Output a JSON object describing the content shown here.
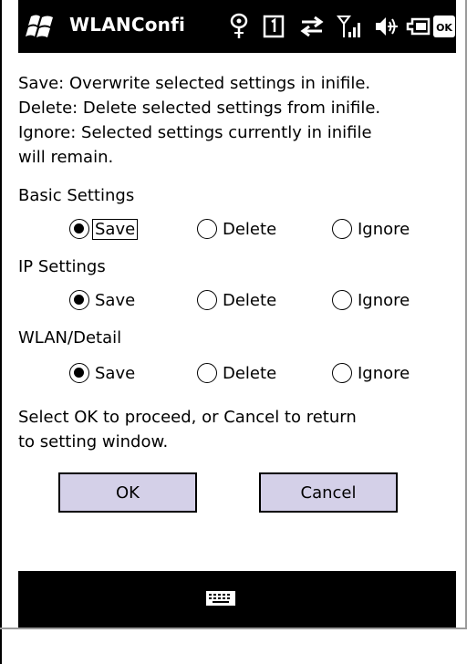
{
  "titlebar": {
    "app_title": "WLANConfi"
  },
  "status_icons": [
    "connectivity-icon",
    "sim-slot-1-icon",
    "data-transfer-icon",
    "signal-strength-icon",
    "volume-icon",
    "battery-icon",
    "ok-button-icon"
  ],
  "ok_badge": "OK",
  "description": {
    "line1": "Save: Overwrite selected settings in inifile.",
    "line2": "Delete: Delete selected settings from inifile.",
    "line3": "Ignore: Selected settings currently in inifile",
    "line4": "will remain."
  },
  "sections": [
    {
      "label": "Basic Settings",
      "selected": "Save"
    },
    {
      "label": "IP Settings",
      "selected": "Save"
    },
    {
      "label": "WLAN/Detail",
      "selected": "Save"
    }
  ],
  "options": {
    "save": "Save",
    "delete": "Delete",
    "ignore": "Ignore"
  },
  "instruction": {
    "line1": "Select OK to proceed, or Cancel to return",
    "line2": "to setting window."
  },
  "buttons": {
    "ok": "OK",
    "cancel": "Cancel"
  },
  "menubar": {
    "center_icon": "keyboard-icon"
  }
}
